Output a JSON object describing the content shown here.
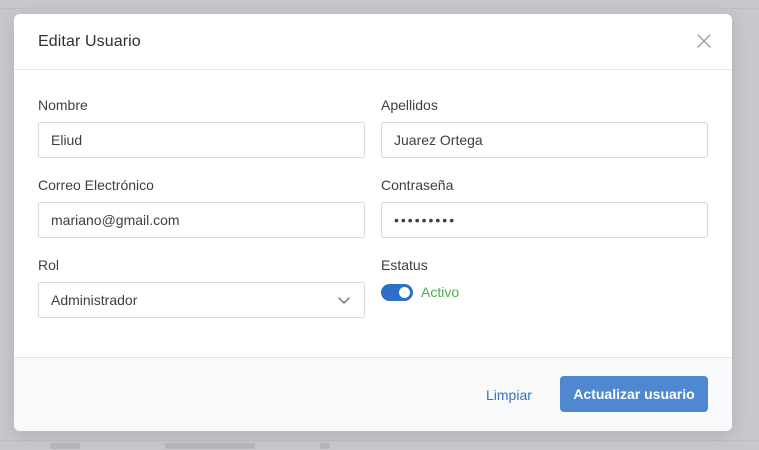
{
  "modal": {
    "title": "Editar Usuario"
  },
  "form": {
    "nombre": {
      "label": "Nombre",
      "value": "Eliud"
    },
    "apellidos": {
      "label": "Apellidos",
      "value": "Juarez Ortega"
    },
    "correo": {
      "label": "Correo Electrónico",
      "value": "mariano@gmail.com"
    },
    "contrasena": {
      "label": "Contraseña",
      "value": "•••••••••"
    },
    "rol": {
      "label": "Rol",
      "value": "Administrador"
    },
    "estatus": {
      "label": "Estatus",
      "value": "Activo",
      "on": true
    }
  },
  "footer": {
    "clear_label": "Limpiar",
    "submit_label": "Actualizar usuario"
  },
  "colors": {
    "primary": "#4d88d0",
    "toggle_on": "#2f6fc8",
    "status_active": "#4caf50",
    "link": "#3c72b8"
  },
  "icons": {
    "close": "close-icon",
    "select": "chevron-down-icon"
  }
}
